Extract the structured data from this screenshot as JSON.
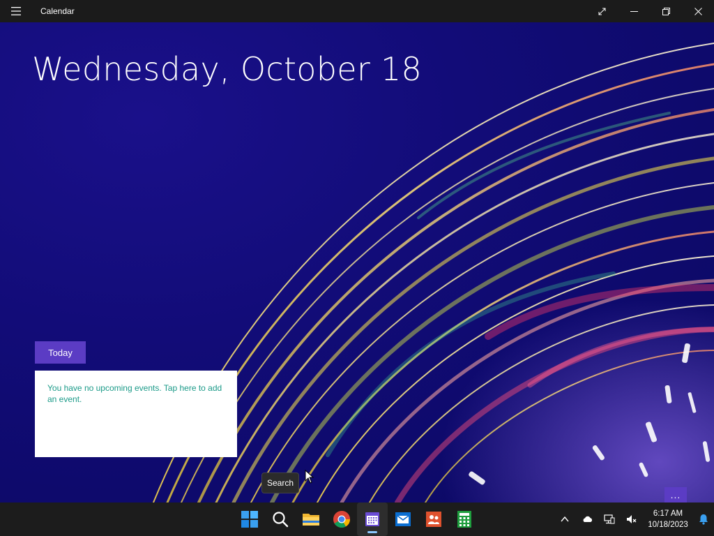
{
  "window": {
    "title": "Calendar"
  },
  "main": {
    "date_heading": "Wednesday, October 18",
    "today_label": "Today",
    "no_events_text": "You have no upcoming events. Tap here to add an event.",
    "more_label": "..."
  },
  "tooltip": {
    "text": "Search"
  },
  "taskbar": {
    "apps": [
      {
        "name": "Start",
        "icon": "windows-start-icon"
      },
      {
        "name": "Search",
        "icon": "search-icon"
      },
      {
        "name": "File Explorer",
        "icon": "folder-icon"
      },
      {
        "name": "Google Chrome",
        "icon": "chrome-icon"
      },
      {
        "name": "Calendar",
        "icon": "calendar-icon",
        "active": true
      },
      {
        "name": "Mail",
        "icon": "mail-icon"
      },
      {
        "name": "People",
        "icon": "people-icon"
      },
      {
        "name": "Calculator",
        "icon": "calculator-icon"
      }
    ],
    "clock": {
      "time": "6:17 AM",
      "date": "10/18/2023"
    }
  },
  "colors": {
    "accent": "#5b3cc4",
    "event_text": "#1a9a88",
    "titlebar": "#1b1b1b",
    "taskbar": "#1c1c1c"
  }
}
